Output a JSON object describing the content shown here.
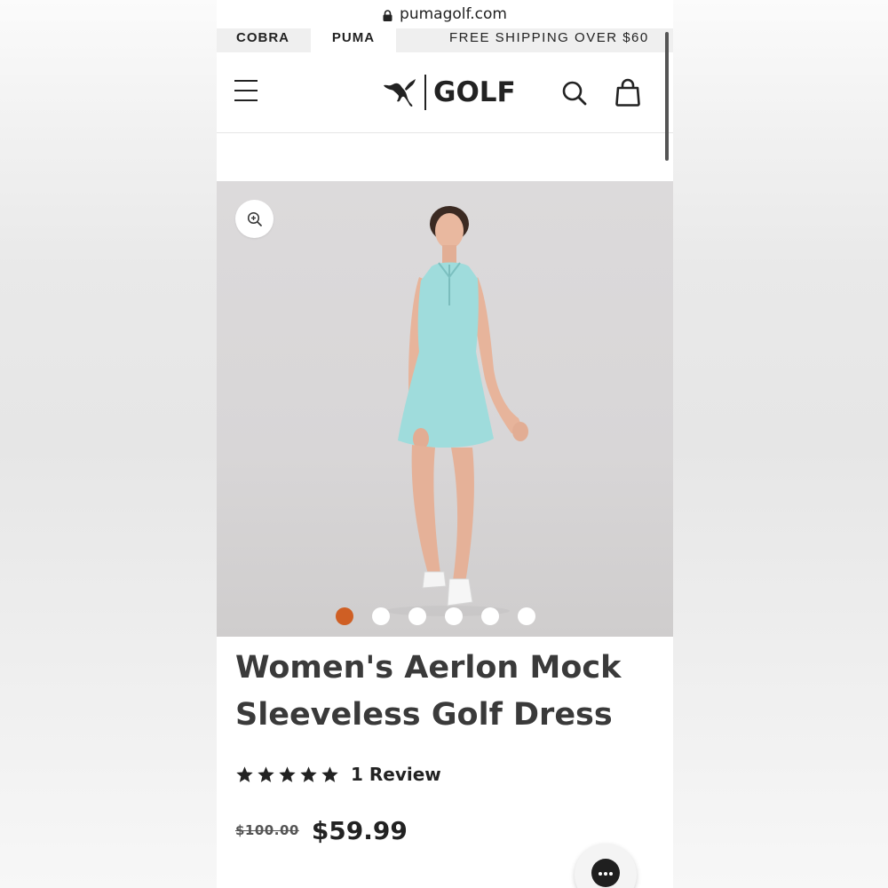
{
  "browser": {
    "url": "pumagolf.com"
  },
  "brand_tabs": [
    {
      "label": "COBRA",
      "active": false
    },
    {
      "label": "PUMA",
      "active": true
    }
  ],
  "promo": {
    "text": "FREE SHIPPING OVER $60"
  },
  "header": {
    "logo_text": "GOLF",
    "icons": [
      "menu-icon",
      "puma-cat-icon",
      "search-icon",
      "shopping-bag-icon"
    ]
  },
  "gallery": {
    "zoom_icon": "zoom-in-icon",
    "image_count": 6,
    "active_index": 0,
    "active_color": "#cf5f24",
    "dress_color": "#9fdcdc"
  },
  "product": {
    "title": "Women's Aerlon Mock Sleeveless Golf Dress",
    "rating": 5,
    "review_count_label": "1 Review",
    "original_price": "$100.00",
    "sale_price": "$59.99"
  },
  "chat": {
    "icon": "chat-bubble-icon"
  }
}
